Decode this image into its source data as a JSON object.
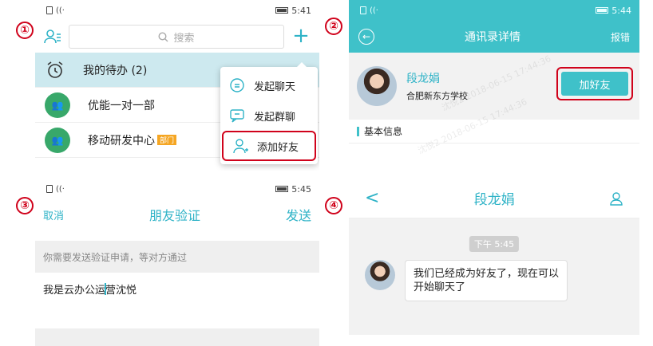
{
  "steps": [
    "①",
    "②",
    "③",
    "④"
  ],
  "panel1": {
    "status": {
      "time": "5:41"
    },
    "search": {
      "placeholder": "搜索"
    },
    "list": [
      {
        "label": "我的待办 (2)"
      },
      {
        "label": "优能一对一部"
      },
      {
        "label": "移动研发中心",
        "tag": "部门"
      }
    ],
    "popup": [
      {
        "label": "发起聊天",
        "icon": "chat-icon"
      },
      {
        "label": "发起群聊",
        "icon": "group-chat-icon"
      },
      {
        "label": "添加好友",
        "icon": "add-user-icon"
      }
    ]
  },
  "panel2": {
    "status": {
      "time": "5:44"
    },
    "title": "通讯录详情",
    "report": "报错",
    "name": "段龙娟",
    "school": "合肥新东方学校",
    "add_friend": "加好友",
    "section": "基本信息",
    "watermark1": "沈悦2 2018-06-15 17:44:36",
    "watermark2": "沈悦2 2018-06-15 17:44:36"
  },
  "panel3": {
    "status": {
      "time": "5:45"
    },
    "cancel": "取消",
    "title": "朋友验证",
    "send": "发送",
    "hint": "你需要发送验证申请，等对方通过",
    "input_before": "我是云办公运",
    "input_after": "营沈悦"
  },
  "panel4": {
    "title": "段龙娟",
    "time": "下午 5:45",
    "message": "我们已经成为好友了，现在可以开始聊天了"
  },
  "colors": {
    "accent": "#3fc1c9",
    "highlight": "#d0021b"
  }
}
